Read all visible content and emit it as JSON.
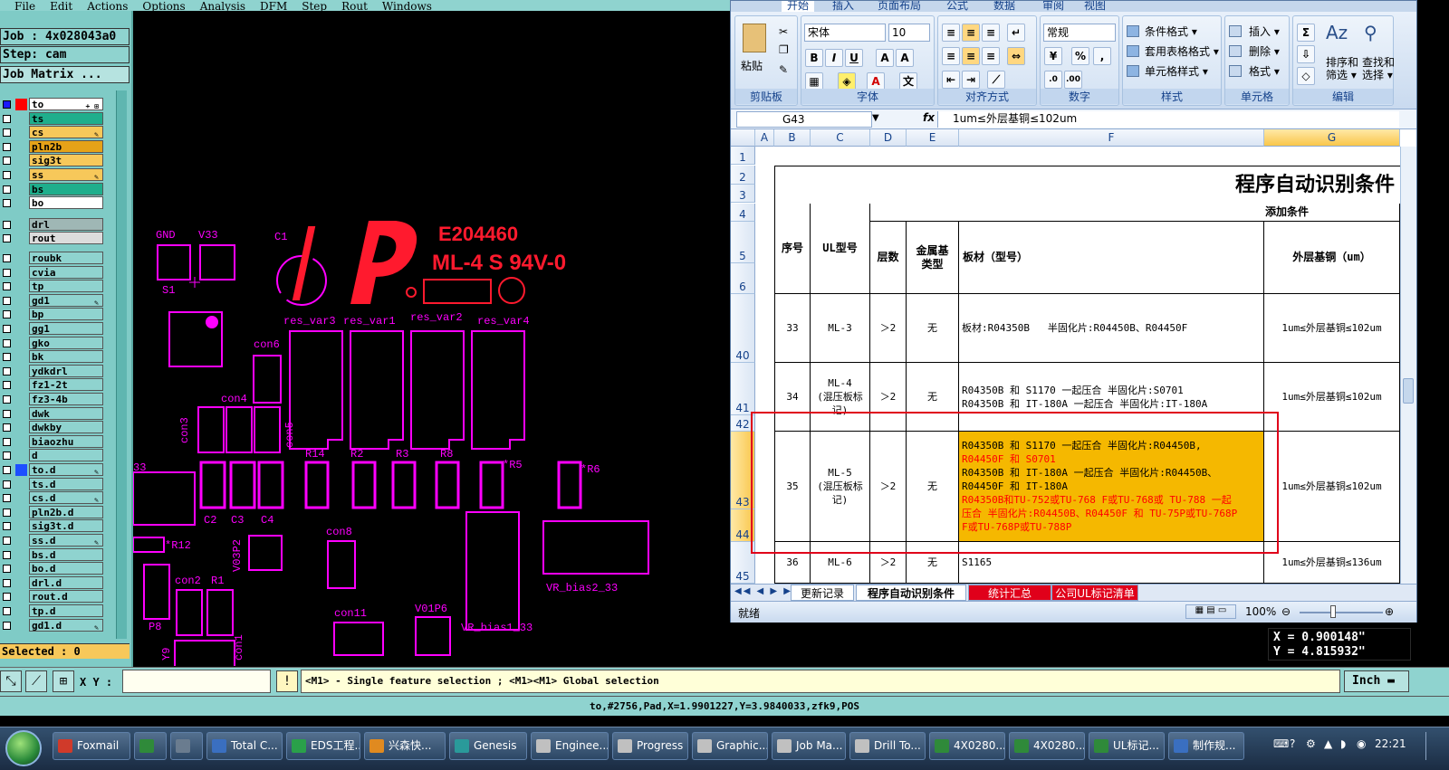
{
  "cam": {
    "menus": [
      "File",
      "Edit",
      "Actions",
      "Options",
      "Analysis",
      "DFM",
      "Step",
      "Rout",
      "Windows"
    ],
    "job_label": "Job : 4x028043a0",
    "step_label": "Step: cam",
    "job_matrix_button": "Job Matrix ...",
    "layers": [
      {
        "name": "to",
        "color": "#ffffff",
        "swatch": "#ff0000",
        "checked_blue": true,
        "pen": "+ ⊞"
      },
      {
        "name": "ts",
        "color": "#1fae8c",
        "swatch": "",
        "pen": ""
      },
      {
        "name": "cs",
        "color": "#f7c85a",
        "swatch": "",
        "pen": "✎"
      },
      {
        "name": "pln2b",
        "color": "#e6a218",
        "swatch": "",
        "pen": ""
      },
      {
        "name": "sig3t",
        "color": "#f7c85a",
        "swatch": "",
        "pen": ""
      },
      {
        "name": "ss",
        "color": "#f7c85a",
        "swatch": "",
        "pen": "✎"
      },
      {
        "name": "bs",
        "color": "#1fae8c",
        "swatch": "",
        "pen": ""
      },
      {
        "name": "bo",
        "color": "#ffffff",
        "swatch": "",
        "pen": ""
      },
      {
        "name": "drl",
        "color": "#9fb7b5",
        "swatch": "",
        "pen": ""
      },
      {
        "name": "rout",
        "color": "#dcdcdc",
        "swatch": "",
        "pen": ""
      },
      {
        "name": "roubk",
        "color": "#8fd3cf",
        "swatch": "",
        "pen": ""
      },
      {
        "name": "cvia",
        "color": "#8fd3cf",
        "swatch": "",
        "pen": ""
      },
      {
        "name": "tp",
        "color": "#8fd3cf",
        "swatch": "",
        "pen": ""
      },
      {
        "name": "gd1",
        "color": "#8fd3cf",
        "swatch": "",
        "pen": "✎"
      },
      {
        "name": "bp",
        "color": "#8fd3cf",
        "swatch": "",
        "pen": ""
      },
      {
        "name": "gg1",
        "color": "#8fd3cf",
        "swatch": "",
        "pen": ""
      },
      {
        "name": "gko",
        "color": "#8fd3cf",
        "swatch": "",
        "pen": ""
      },
      {
        "name": "bk",
        "color": "#8fd3cf",
        "swatch": "",
        "pen": ""
      },
      {
        "name": "ydkdrl",
        "color": "#8fd3cf",
        "swatch": "",
        "pen": ""
      },
      {
        "name": "fz1-2t",
        "color": "#8fd3cf",
        "swatch": "",
        "pen": ""
      },
      {
        "name": "fz3-4b",
        "color": "#8fd3cf",
        "swatch": "",
        "pen": ""
      },
      {
        "name": "dwk",
        "color": "#8fd3cf",
        "swatch": "",
        "pen": ""
      },
      {
        "name": "dwkby",
        "color": "#8fd3cf",
        "swatch": "",
        "pen": ""
      },
      {
        "name": "biaozhu",
        "color": "#8fd3cf",
        "swatch": "",
        "pen": ""
      },
      {
        "name": "d",
        "color": "#8fd3cf",
        "swatch": "",
        "pen": ""
      },
      {
        "name": "to.d",
        "color": "#8fd3cf",
        "swatch": "#1d4fff",
        "pen": "✎"
      },
      {
        "name": "ts.d",
        "color": "#8fd3cf",
        "swatch": "",
        "pen": ""
      },
      {
        "name": "cs.d",
        "color": "#8fd3cf",
        "swatch": "",
        "pen": "✎"
      },
      {
        "name": "pln2b.d",
        "color": "#8fd3cf",
        "swatch": "",
        "pen": ""
      },
      {
        "name": "sig3t.d",
        "color": "#8fd3cf",
        "swatch": "",
        "pen": ""
      },
      {
        "name": "ss.d",
        "color": "#8fd3cf",
        "swatch": "",
        "pen": "✎"
      },
      {
        "name": "bs.d",
        "color": "#8fd3cf",
        "swatch": "",
        "pen": ""
      },
      {
        "name": "bo.d",
        "color": "#8fd3cf",
        "swatch": "",
        "pen": ""
      },
      {
        "name": "drl.d",
        "color": "#8fd3cf",
        "swatch": "",
        "pen": ""
      },
      {
        "name": "rout.d",
        "color": "#8fd3cf",
        "swatch": "",
        "pen": ""
      },
      {
        "name": "tp.d",
        "color": "#8fd3cf",
        "swatch": "",
        "pen": ""
      },
      {
        "name": "gd1.d",
        "color": "#8fd3cf",
        "swatch": "",
        "pen": "✎"
      }
    ],
    "selected_label": "Selected : 0",
    "xy_label": "X Y :",
    "message": "<M1> - Single feature selection ; <M1><M1> Global selection",
    "units_button": "Inch",
    "status_line": "to,#2756,Pad,X=1.9901227,Y=3.9840033,zfk9,POS",
    "coord_x": "X = 0.900148\"",
    "coord_y": "Y = 4.815932\"",
    "silkscreen": {
      "ul_number": "E204460",
      "rating": "ML-4 S 94V-0",
      "labels": [
        "GND",
        "V33",
        "C1",
        "S1",
        "con6",
        "con4",
        "con3",
        "con5",
        "R14",
        "R2",
        "R3",
        "R8",
        "*R5",
        "*R6",
        "33",
        "C2",
        "C3",
        "C4",
        "*R12",
        "V03P2",
        "con8",
        "con2",
        "R1",
        "P8",
        "Y9",
        "con11",
        "V01P6",
        "VR_bias1_33",
        "VR_bias2_33",
        "res_var3",
        "res_var1",
        "res_var2",
        "res_var4",
        "con1"
      ]
    }
  },
  "excel": {
    "tabs": [
      "开始",
      "插入",
      "页面布局",
      "公式",
      "数据",
      "审阅",
      "视图"
    ],
    "clipboard_group": "剪贴板",
    "paste_label": "粘贴",
    "font_group": "字体",
    "font_name": "宋体",
    "font_size": "10",
    "align_group": "对齐方式",
    "number_group": "数字",
    "number_format": "常规",
    "styles_group": "样式",
    "style_items": [
      "条件格式 ▾",
      "套用表格格式 ▾",
      "单元格样式 ▾"
    ],
    "cells_group": "单元格",
    "cells_items": [
      "插入 ▾",
      "删除 ▾",
      "格式 ▾"
    ],
    "edit_group": "编辑",
    "sort_label": "排序和\n筛选 ▾",
    "find_label": "查找和\n选择 ▾",
    "name_box": "G43",
    "fx": "fx",
    "formula": "1um≤外层基铜≤102um",
    "columns": [
      "A",
      "B",
      "C",
      "D",
      "E",
      "F",
      "G"
    ],
    "row_numbers": [
      "1",
      "2",
      "3",
      "4",
      "5",
      "6",
      "40",
      "41",
      "42",
      "43",
      "44",
      "45"
    ],
    "sheet_title": "程序自动识别条件",
    "add_condition_header": "添加条件",
    "headers": {
      "seq": "序号",
      "ul_type": "UL型号",
      "layers": "层数",
      "metal_base": "金属基\n类型",
      "material": "板材（型号）",
      "outer_copper": "外层基铜（um）"
    },
    "rows": [
      {
        "seq": "33",
        "ul": "ML-3",
        "layers": "＞2",
        "metal": "无",
        "material": "板材:R04350B   半固化片:R04450B、R04450F",
        "copper": "1um≤外层基铜≤102um"
      },
      {
        "seq": "34",
        "ul": "ML-4\n(混压板标\n记)",
        "layers": "＞2",
        "metal": "无",
        "material": "R04350B 和 S1170 一起压合 半固化片:S0701\nR04350B 和 IT-180A 一起压合 半固化片:IT-180A",
        "copper": "1um≤外层基铜≤102um"
      },
      {
        "seq": "35",
        "ul": "ML-5\n(混压板标\n记)",
        "layers": "＞2",
        "metal": "无",
        "material_lines": [
          {
            "text": "R04350B 和 S1170 一起压合 半固化片:R04450B,",
            "color": "#000000"
          },
          {
            "text": "R04450F 和 S0701",
            "color": "#ff0000"
          },
          {
            "text": "R04350B 和 IT-180A 一起压合 半固化片:R04450B、",
            "color": "#000000"
          },
          {
            "text": "R04450F 和 IT-180A",
            "color": "#000000"
          },
          {
            "text": "R04350B和TU-752或TU-768 F或TU-768或 TU-788  一起",
            "color": "#ff0000"
          },
          {
            "text": "压合 半固化片:R04450B、R04450F 和 TU-75P或TU-768P",
            "color": "#ff0000"
          },
          {
            "text": "F或TU-768P或TU-788P",
            "color": "#ff0000"
          }
        ],
        "copper": "1um≤外层基铜≤102um"
      },
      {
        "seq": "36",
        "ul": "ML-6",
        "layers": "＞2",
        "metal": "无",
        "material": "S1165",
        "copper": "1um≤外层基铜≤136um"
      }
    ],
    "sheet_tabs": [
      "更新记录",
      "程序自动识别条件",
      "统计汇总",
      "公司UL标记清单"
    ],
    "status_ready": "就绪",
    "zoom": "100%"
  },
  "taskbar": {
    "items": [
      "Foxmail",
      "",
      "",
      "Total C...",
      "EDS工程...",
      "兴森快...",
      "Genesis",
      "Enginee...",
      "Progress",
      "Graphic...",
      "Job Ma...",
      "Drill To...",
      "4X0280...",
      "4X0280...",
      "UL标记...",
      "制作规..."
    ],
    "clock": "22:21"
  },
  "colors": {
    "cam_panel": "#8fd3cf",
    "pcb_magenta": "#ff00ff",
    "pcb_red": "#ff1a2e",
    "highlight_fill": "#f5b800",
    "annotation_red": "#e0001a"
  }
}
